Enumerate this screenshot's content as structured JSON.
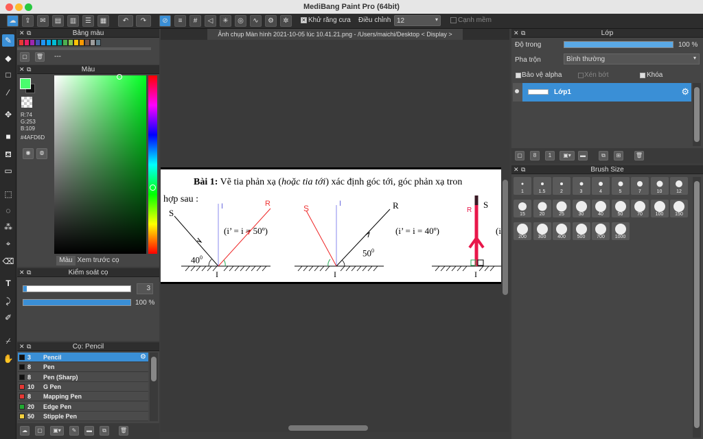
{
  "app": {
    "title": "MediBang Paint Pro (64bit)"
  },
  "toolbar": {
    "antialias_label": "Khử răng cưa",
    "adjust_label": "Điều chỉnh",
    "adjust_value": "12",
    "smooth_edge_label": "Cạnh mềm"
  },
  "palette": {
    "title": "Bảng màu",
    "none_label": "---",
    "swatches": [
      "#e53935",
      "#e91e63",
      "#9c27b0",
      "#3f51b5",
      "#2196f3",
      "#03a9f4",
      "#00bcd4",
      "#009688",
      "#4caf50",
      "#8bc34a",
      "#ffc107",
      "#ff9800",
      "#795548",
      "#9e9e9e",
      "#607d8b"
    ]
  },
  "color": {
    "title": "Màu",
    "r": "R:74",
    "g": "G:253",
    "b": "B:109",
    "hex": "#4AFD6D",
    "tab_color": "Màu",
    "tab_preview": "Xem trước cọ",
    "fg": "#4afd6d"
  },
  "brush_control": {
    "title": "Kiểm soát cọ",
    "size_value": "3",
    "opacity_value": "100 %"
  },
  "brushes": {
    "title": "Cọ: Pencil",
    "items": [
      {
        "size": "3",
        "name": "Pencil",
        "color": "#111111"
      },
      {
        "size": "8",
        "name": "Pen",
        "color": "#111111"
      },
      {
        "size": "8",
        "name": "Pen (Sharp)",
        "color": "#111111"
      },
      {
        "size": "10",
        "name": "G Pen",
        "color": "#e53935"
      },
      {
        "size": "8",
        "name": "Mapping Pen",
        "color": "#e53935"
      },
      {
        "size": "20",
        "name": "Edge Pen",
        "color": "#22aa33"
      },
      {
        "size": "50",
        "name": "Stipple Pen",
        "color": "#f4d03f"
      }
    ]
  },
  "document": {
    "tab_title": "Ảnh chụp Màn hình 2021-10-05 lúc 10.41.21.png - /Users/maichi/Desktop < Display >",
    "problem": "Bài 1:",
    "problem_text_a": "Vẽ tia phản xạ (",
    "problem_text_italic": "hoặc tia tới",
    "problem_text_b": ") xác định góc tới, góc phản xạ tron",
    "line2": "hợp sau :",
    "f1_eq": "(i’ = i = 50º)",
    "f1_angle": "40",
    "f2_eq": "(i’ = i = 40º)",
    "f2_angle": "50",
    "f3_eq": "(i",
    "label_S": "S",
    "label_I": "I",
    "label_R": "R",
    "deg": "0"
  },
  "layers": {
    "title": "Lớp",
    "opacity_label": "Độ trong",
    "opacity_value": "100 %",
    "blend_label": "Pha trộn",
    "blend_value": "Bình thường",
    "protect_alpha": "Bảo vệ alpha",
    "clipping": "Xén bớt",
    "lock": "Khóa",
    "layer_name": "Lớp1"
  },
  "brush_size": {
    "title": "Brush Size",
    "sizes": [
      "1",
      "1.5",
      "2",
      "3",
      "4",
      "5",
      "7",
      "10",
      "12",
      "15",
      "20",
      "25",
      "30",
      "40",
      "50",
      "70",
      "100",
      "150",
      "200",
      "300",
      "400",
      "500",
      "700",
      "1000"
    ]
  }
}
